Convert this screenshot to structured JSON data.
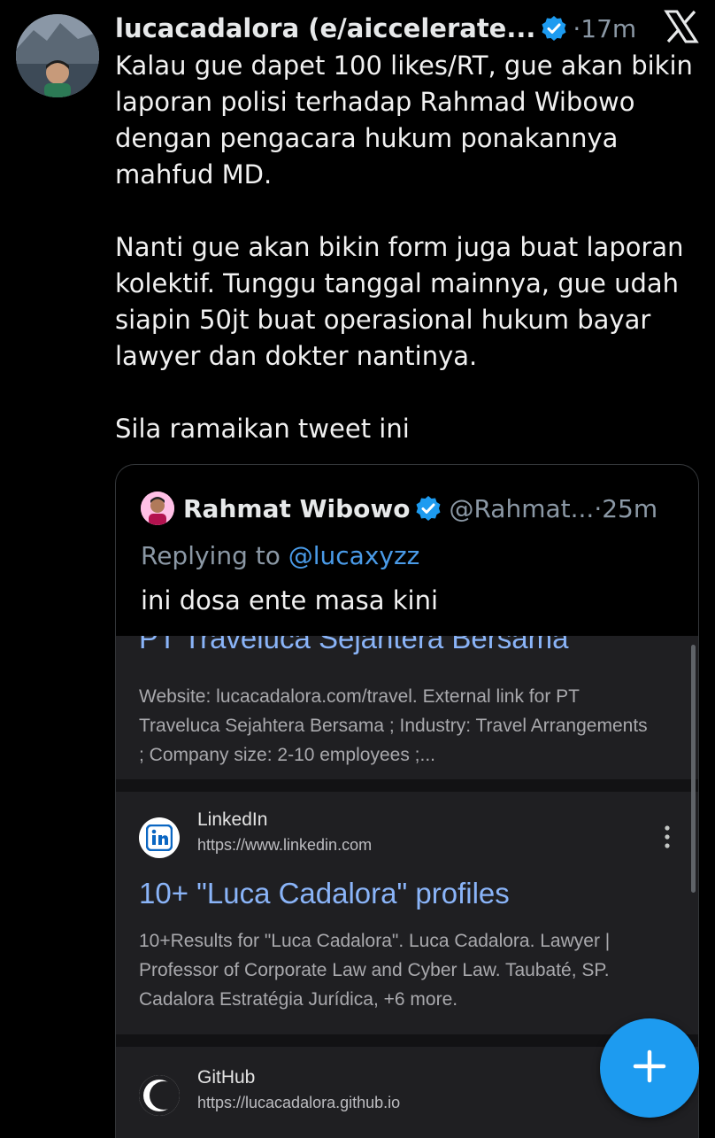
{
  "tweet": {
    "author_name": "lucacadalora (e/aiccelerate...",
    "time": "·17m",
    "paragraphs": [
      "Kalau gue dapet 100 likes/RT, gue akan bikin laporan polisi terhadap Rahmad Wibowo dengan pengacara hukum ponakannya mahfud MD.",
      "Nanti gue akan bikin form juga buat laporan kolektif. Tunggu tanggal mainnya, gue udah siapin 50jt buat operasional hukum bayar lawyer dan dokter nantinya.",
      "Sila ramaikan tweet ini"
    ]
  },
  "quoted_tweet": {
    "author_name": "Rahmat Wibowo",
    "handle_time": "@Rahmat...·25m",
    "replying_prefix": "Replying to ",
    "replying_handle": "@lucaxyzz",
    "text": "ini dosa ente masa kini"
  },
  "screenshot": {
    "cut_title": "PT Traveluca Sejahtera Bersama",
    "result1_snippet": "Website: lucacadalora.com/travel. External link for PT Traveluca Sejahtera Bersama ; Industry: Travel Arrangements ; Company size: 2-10 employees ;...",
    "result2_site": "LinkedIn",
    "result2_url": "https://www.linkedin.com",
    "result2_title": "10+ \"Luca Cadalora\" profiles",
    "result2_snippet": "10+Results for \"Luca Cadalora\". Luca Cadalora. Lawyer | Professor of Corporate Law and Cyber Law. Taubaté, SP. Cadalora Estratégia Jurídica, +6 more.",
    "result3_site": "GitHub",
    "result3_url": "https://lucacadalora.github.io"
  },
  "colors": {
    "background": "#000000",
    "link_blue": "#4a9be8",
    "verified_blue": "#1d9bf0",
    "google_link": "#8ab4f8"
  },
  "icons": [
    "verified-badge-icon",
    "x-logo-icon",
    "linkedin-icon",
    "github-icon",
    "more-options-icon",
    "plus-icon"
  ]
}
